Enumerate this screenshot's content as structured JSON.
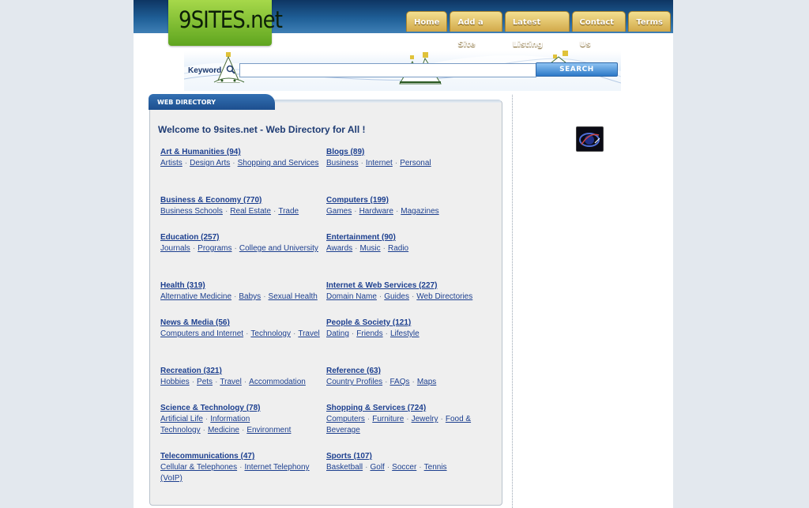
{
  "logo": {
    "text": "9SITES.net"
  },
  "nav": [
    {
      "label": "Home"
    },
    {
      "label": "Add a Site"
    },
    {
      "label": "Latest Listing"
    },
    {
      "label": "Contact Us"
    },
    {
      "label": "Terms"
    }
  ],
  "search": {
    "label": "Keyword",
    "value": "",
    "placeholder": "",
    "button": "SEARCH",
    "icon": "search-icon"
  },
  "directory": {
    "tab": "WEB DIRECTORY",
    "welcome": "Welcome to 9sites.net - Web Directory for All !",
    "categories": [
      {
        "title": "Art & Humanities (94)",
        "subs": [
          "Artists",
          "Design Arts",
          "Shopping and Services"
        ]
      },
      {
        "title": "Blogs (89)",
        "subs": [
          "Business",
          "Internet",
          "Personal"
        ]
      },
      {
        "title": "Business & Economy (770)",
        "subs": [
          "Business Schools",
          "Real Estate",
          "Trade"
        ]
      },
      {
        "title": "Computers (199)",
        "subs": [
          "Games",
          "Hardware",
          "Magazines"
        ]
      },
      {
        "title": "Education (257)",
        "subs": [
          "Journals",
          "Programs",
          "College and University"
        ]
      },
      {
        "title": "Entertainment (90)",
        "subs": [
          "Awards",
          "Music",
          "Radio"
        ]
      },
      {
        "title": "Health (319)",
        "subs": [
          "Alternative Medicine",
          "Babys",
          "Sexual Health"
        ]
      },
      {
        "title": "Internet & Web Services (227)",
        "subs": [
          "Domain Name",
          "Guides",
          "Web Directories"
        ]
      },
      {
        "title": "News & Media (56)",
        "subs": [
          "Computers and Internet",
          "Technology",
          "Travel"
        ]
      },
      {
        "title": "People & Society (121)",
        "subs": [
          "Dating",
          "Friends",
          "Lifestyle"
        ]
      },
      {
        "title": "Recreation (321)",
        "subs": [
          "Hobbies",
          "Pets",
          "Travel",
          "Accommodation"
        ]
      },
      {
        "title": "Reference (63)",
        "subs": [
          "Country Profiles",
          "FAQs",
          "Maps"
        ]
      },
      {
        "title": "Science & Technology (78)",
        "subs": [
          "Artificial Life",
          "Information Technology",
          "Medicine",
          "Environment"
        ]
      },
      {
        "title": "Shopping & Services (724)",
        "subs": [
          "Computers",
          "Furniture",
          "Jewelry",
          "Food & Beverage"
        ]
      },
      {
        "title": "Telecommunications (47)",
        "subs": [
          "Cellular & Telephones",
          "Internet Telephony (VoIP)"
        ]
      },
      {
        "title": "Sports (107)",
        "subs": [
          "Basketball",
          "Golf",
          "Soccer",
          "Tennis"
        ]
      }
    ]
  },
  "sidebar": {
    "badge_icon": "space-badge-icon"
  }
}
